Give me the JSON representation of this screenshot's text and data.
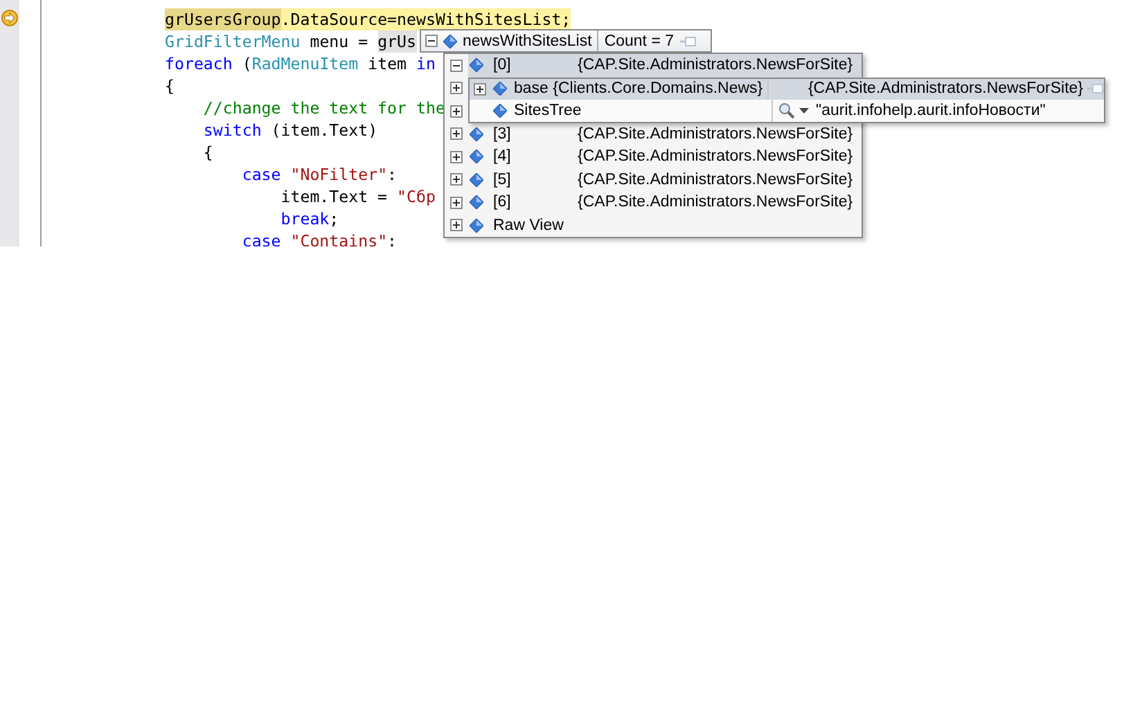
{
  "editor": {
    "lines": [
      {
        "current": true,
        "segments": [
          {
            "kind": "ref",
            "text": "grUsersGroup"
          },
          {
            "kind": "plain",
            "text": ".DataSource=newsWithSitesList;"
          }
        ]
      },
      {
        "current": false,
        "segments": [
          {
            "kind": "type",
            "text": "GridFilterMenu"
          },
          {
            "kind": "plain",
            "text": " menu = "
          },
          {
            "kind": "ref",
            "text": "grUs"
          }
        ]
      },
      {
        "current": false,
        "segments": [
          {
            "kind": "keyword",
            "text": "foreach"
          },
          {
            "kind": "plain",
            "text": " ("
          },
          {
            "kind": "type",
            "text": "RadMenuItem"
          },
          {
            "kind": "plain",
            "text": " item "
          },
          {
            "kind": "keyword",
            "text": "in"
          }
        ]
      },
      {
        "current": false,
        "segments": [
          {
            "kind": "plain",
            "text": "{"
          }
        ]
      },
      {
        "current": false,
        "segments": [
          {
            "kind": "comment",
            "text": "    //change the text for the"
          }
        ]
      },
      {
        "current": false,
        "segments": [
          {
            "kind": "keyword",
            "text": "    switch"
          },
          {
            "kind": "plain",
            "text": " (item.Text)"
          }
        ]
      },
      {
        "current": false,
        "segments": [
          {
            "kind": "plain",
            "text": "    {"
          }
        ]
      },
      {
        "current": false,
        "segments": [
          {
            "kind": "keyword",
            "text": "        case"
          },
          {
            "kind": "string",
            "text": " \"NoFilter\""
          },
          {
            "kind": "plain",
            "text": ":"
          }
        ]
      },
      {
        "current": false,
        "segments": [
          {
            "kind": "plain",
            "text": "            item.Text = "
          },
          {
            "kind": "string",
            "text": "\"Сбр"
          }
        ]
      },
      {
        "current": false,
        "segments": [
          {
            "kind": "keyword",
            "text": "            break"
          },
          {
            "kind": "plain",
            "text": ";"
          }
        ]
      },
      {
        "current": false,
        "segments": [
          {
            "kind": "keyword",
            "text": "        case"
          },
          {
            "kind": "string",
            "text": " \"Contains\""
          },
          {
            "kind": "plain",
            "text": ":"
          }
        ]
      }
    ]
  },
  "datatip": {
    "name": "newsWithSitesList",
    "value": "Count = 7",
    "expanded": true,
    "items": [
      {
        "name": "[0]",
        "value": "{CAP.Site.Administrators.NewsForSite}",
        "expanded": true,
        "selected": true,
        "children": [
          {
            "name": "base {Clients.Core.Domains.News}",
            "value": "{CAP.Site.Administrators.NewsForSite}",
            "kind": "object",
            "expanded": false,
            "selected": true
          },
          {
            "name": "SitesTree",
            "value": "\"aurit.infohelp.aurit.infoНовости\"",
            "kind": "string",
            "selected": false
          }
        ]
      },
      {
        "expanded": false
      },
      {
        "expanded": false
      },
      {
        "name": "[3]",
        "value": "{CAP.Site.Administrators.NewsForSite}",
        "expanded": false,
        "selected": false
      },
      {
        "name": "[4]",
        "value": "{CAP.Site.Administrators.NewsForSite}",
        "expanded": false,
        "selected": false
      },
      {
        "name": "[5]",
        "value": "{CAP.Site.Administrators.NewsForSite}",
        "expanded": false,
        "selected": false
      },
      {
        "name": "[6]",
        "value": "{CAP.Site.Administrators.NewsForSite}",
        "expanded": false,
        "selected": false
      },
      {
        "name": "Raw View",
        "expanded": false,
        "selected": false
      }
    ]
  }
}
